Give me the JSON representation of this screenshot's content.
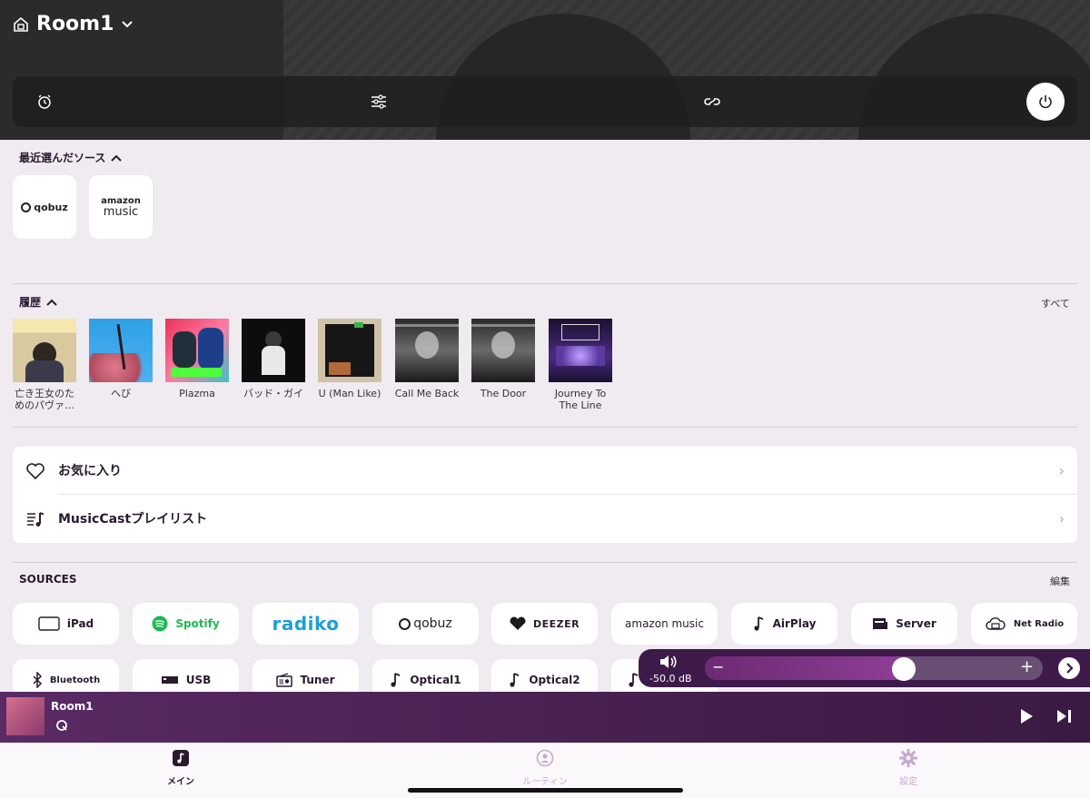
{
  "header": {
    "room_name": "Room1"
  },
  "recent_sources": {
    "title": "最近選んだソース",
    "items": [
      {
        "name": "qobuz",
        "label": "qobuz"
      },
      {
        "name": "amazon-music",
        "label1": "amazon",
        "label2": "music"
      }
    ]
  },
  "history": {
    "title": "履歴",
    "see_all": "すべて",
    "items": [
      {
        "label": "亡き王女のためのパヴァ…"
      },
      {
        "label": "へび"
      },
      {
        "label": "Plazma"
      },
      {
        "label": "バッド・ガイ"
      },
      {
        "label": "U (Man Like)"
      },
      {
        "label": "Call Me Back"
      },
      {
        "label": "The Door"
      },
      {
        "label": "Journey To The Line (Liv…"
      }
    ]
  },
  "list": {
    "favorites": "お気に入り",
    "playlists": "MusicCastプレイリスト"
  },
  "sources": {
    "title": "SOURCES",
    "edit": "編集",
    "row1": [
      {
        "label": "iPad"
      },
      {
        "label": "Spotify"
      },
      {
        "label": "radiko"
      },
      {
        "label": "qobuz"
      },
      {
        "label": "DEEZER"
      },
      {
        "label": "amazon music"
      },
      {
        "label": "AirPlay"
      },
      {
        "label": "Server"
      },
      {
        "label": "Net Radio"
      }
    ],
    "row2": [
      {
        "label": "Bluetooth"
      },
      {
        "label": "USB"
      },
      {
        "label": "Tuner"
      },
      {
        "label": "Optical1"
      },
      {
        "label": "Optical2"
      }
    ]
  },
  "volume": {
    "db": "-50.0 dB",
    "level": 0.59,
    "minus": "−",
    "plus": "+"
  },
  "player": {
    "room": "Room1"
  },
  "tabs": [
    {
      "label": "メイン",
      "active": true
    },
    {
      "label": "ルーティン",
      "active": false
    },
    {
      "label": "設定",
      "active": false
    }
  ],
  "colors": {
    "accent": "#4a1f55",
    "background": "#f0eaf1",
    "spotify": "#1db954",
    "radiko": "#1e9fd8"
  }
}
